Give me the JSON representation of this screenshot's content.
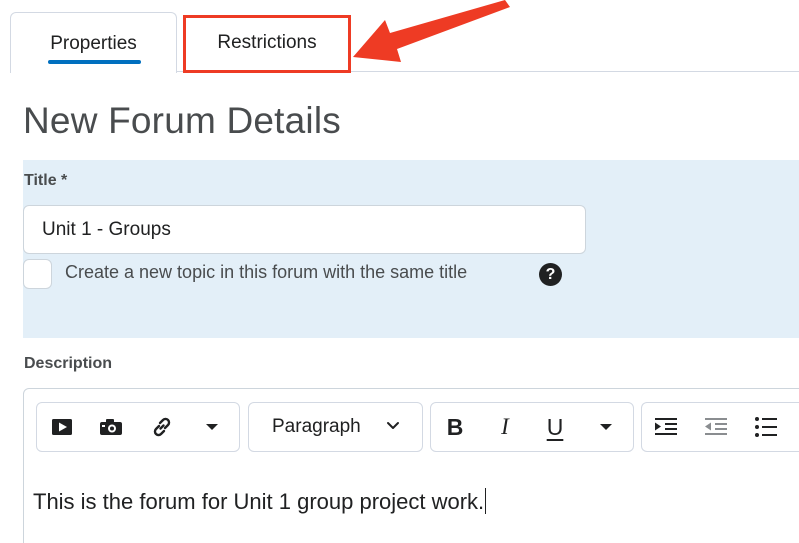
{
  "tabs": [
    {
      "label": "Properties",
      "active": true
    },
    {
      "label": "Restrictions",
      "active": false
    }
  ],
  "page": {
    "title": "New Forum Details"
  },
  "form": {
    "title_label": "Title *",
    "title_value": "Unit 1 - Groups",
    "same_title_checkbox": {
      "label": "Create a new topic in this forum with the same title",
      "checked": false
    },
    "help_glyph": "?",
    "description_label": "Description"
  },
  "editor": {
    "toolbar": {
      "insert_stuff": "video-icon",
      "insert_quicklink_camera": "camera-icon",
      "insert_link": "link-icon",
      "more_insert": "caret-down-icon",
      "format_select": "Paragraph",
      "bold": "B",
      "italic": "I",
      "underline": "U",
      "more_format": "caret-down-icon",
      "indent": "indent-icon",
      "outdent": "outdent-icon",
      "bullet_list": "bullet-list-icon"
    },
    "content": "This is the forum for Unit 1 group project work."
  },
  "colors": {
    "accent": "#006fbf",
    "highlight_annotation": "#ee3b24",
    "panel_background": "#e3eff8",
    "text": "#494c4e"
  }
}
